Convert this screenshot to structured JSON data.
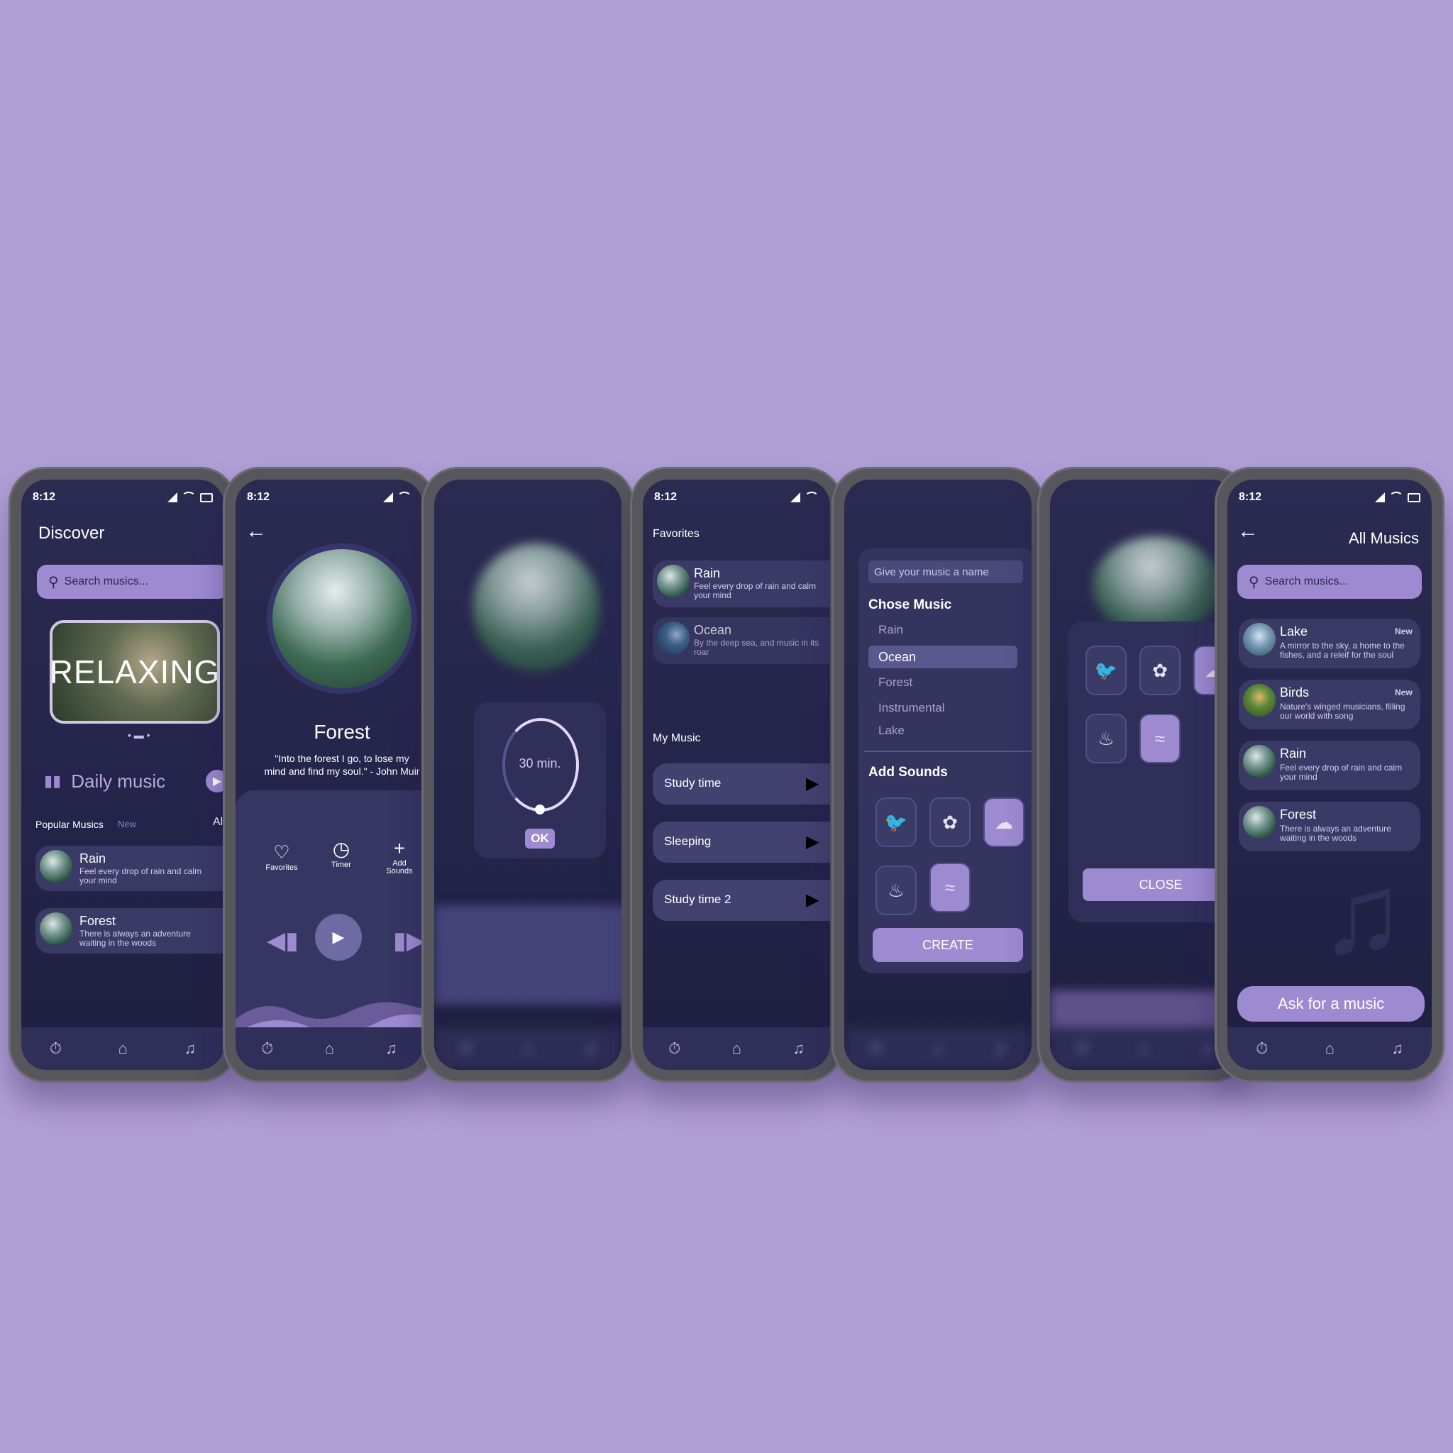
{
  "status": {
    "time": "8:12"
  },
  "discover": {
    "title": "Discover",
    "search_placeholder": "Search musics...",
    "banner": "RELAXING",
    "daily": "Daily music",
    "popular": "Popular Musics",
    "new_tag": "New",
    "all": "All",
    "items": [
      {
        "title": "Rain",
        "desc": "Feel every drop of rain and calm your mind"
      },
      {
        "title": "Forest",
        "desc": "There is always an adventure waiting in the woods"
      }
    ]
  },
  "player": {
    "title": "Forest",
    "quote": "\"Into the forest I go, to lose my mind and find my soul.\" - John Muir",
    "actions": [
      "Favorites",
      "Timer",
      "Add Sounds"
    ]
  },
  "timer": {
    "value": "30 min.",
    "ok": "OK"
  },
  "library": {
    "favorites": "Favorites",
    "fav_items": [
      {
        "title": "Rain",
        "desc": "Feel every drop of rain and calm your mind"
      },
      {
        "title": "Ocean",
        "desc": "By the deep sea, and music in its roar"
      }
    ],
    "my_music": "My Music",
    "playlists": [
      "Study time",
      "Sleeping",
      "Study time 2"
    ]
  },
  "create": {
    "name_placeholder": "Give your music a name",
    "chose": "Chose Music",
    "options": [
      "Rain",
      "Ocean",
      "Forest",
      "Instrumental",
      "Lake"
    ],
    "add_sounds": "Add Sounds",
    "button": "CREATE"
  },
  "sounds": {
    "close": "CLOSE"
  },
  "all": {
    "title": "All Musics",
    "search_placeholder": "Search musics...",
    "items": [
      {
        "title": "Lake",
        "badge": "New",
        "desc": "A mirror to the sky, a home to the fishes, and a releif for the soul"
      },
      {
        "title": "Birds",
        "badge": "New",
        "desc": "Nature's winged musicians, filling our world with song"
      },
      {
        "title": "Rain",
        "badge": "",
        "desc": "Feel every drop of rain and calm your mind"
      },
      {
        "title": "Forest",
        "badge": "",
        "desc": "There is always an adventure waiting in the woods"
      }
    ],
    "ask": "Ask for a music"
  }
}
